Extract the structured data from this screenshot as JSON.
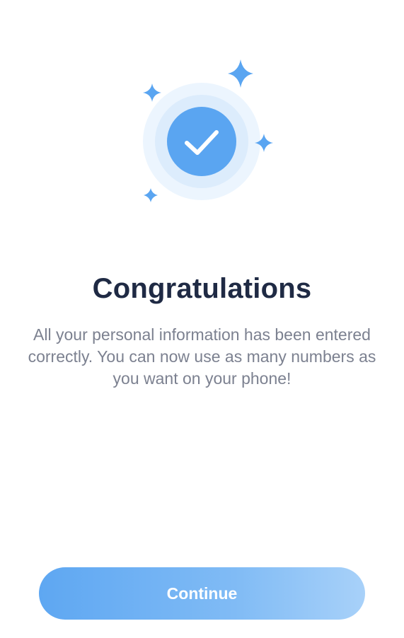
{
  "success_screen": {
    "title": "Congratulations",
    "message": "All your personal information has been entered correctly. You can now use as many numbers as you want on your phone!",
    "continue_label": "Continue"
  },
  "colors": {
    "accent": "#5aa5f1",
    "halo_outer": "#ecf5fe",
    "halo_inner": "#dcecfc",
    "title": "#1f2a44",
    "body_text": "#7c8190"
  },
  "icons": {
    "success": "checkmark-icon",
    "decoration": "sparkle-icon"
  }
}
